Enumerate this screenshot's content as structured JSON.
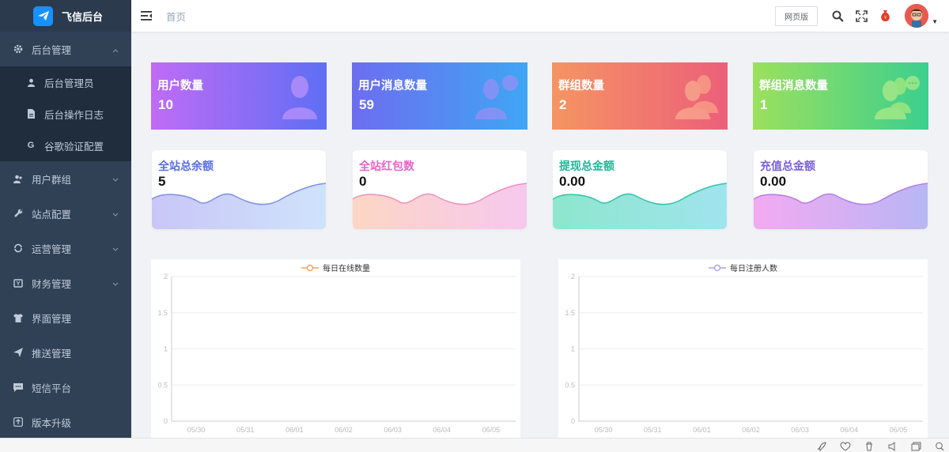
{
  "app": {
    "title": "飞信后台"
  },
  "sidebar": {
    "items": [
      {
        "label": "后台管理",
        "icon": "gear-icon",
        "expanded": true,
        "children": [
          {
            "label": "后台管理员",
            "icon": "user-icon"
          },
          {
            "label": "后台操作日志",
            "icon": "document-icon"
          },
          {
            "label": "谷歌验证配置",
            "icon": "google-icon"
          }
        ]
      },
      {
        "label": "用户群组",
        "icon": "user-group-icon"
      },
      {
        "label": "站点配置",
        "icon": "wrench-icon"
      },
      {
        "label": "运营管理",
        "icon": "sync-icon"
      },
      {
        "label": "财务管理",
        "icon": "wallet-icon"
      },
      {
        "label": "界面管理",
        "icon": "shirt-icon"
      },
      {
        "label": "推送管理",
        "icon": "send-icon"
      },
      {
        "label": "短信平台",
        "icon": "message-icon"
      },
      {
        "label": "版本升级",
        "icon": "upgrade-icon"
      }
    ]
  },
  "header": {
    "breadcrumb": "首页",
    "web_version": "网页版"
  },
  "stats": [
    {
      "label": "用户数量",
      "value": "10"
    },
    {
      "label": "用户消息数量",
      "value": "59"
    },
    {
      "label": "群组数量",
      "value": "2"
    },
    {
      "label": "群组消息数量",
      "value": "1"
    }
  ],
  "waves": [
    {
      "label": "全站总余额",
      "value": "5",
      "color": "#5b6ee1"
    },
    {
      "label": "全站红包数",
      "value": "0",
      "color": "#e963c8"
    },
    {
      "label": "提现总金额",
      "value": "0.00",
      "color": "#23b59b"
    },
    {
      "label": "充值总金额",
      "value": "0.00",
      "color": "#7b61d8"
    }
  ],
  "chart_data": [
    {
      "type": "line",
      "title": "",
      "x": [
        "05/30",
        "05/31",
        "06/01",
        "06/02",
        "06/03",
        "06/04",
        "06/05"
      ],
      "series": [
        {
          "name": "每日在线数量",
          "values": [],
          "color": "#f4a261"
        }
      ],
      "yticks": [
        "0",
        "0.5",
        "1",
        "1.5",
        "2"
      ],
      "ylim": [
        0,
        2
      ],
      "grid": true,
      "legend": "top-center"
    },
    {
      "type": "line",
      "title": "",
      "x": [
        "05/30",
        "05/31",
        "06/01",
        "06/02",
        "06/03",
        "06/04",
        "06/05"
      ],
      "series": [
        {
          "name": "每日注册人数",
          "values": [],
          "color": "#a7a4e8"
        }
      ],
      "yticks": [
        "0",
        "0.5",
        "1",
        "1.5",
        "2"
      ],
      "ylim": [
        0,
        2
      ],
      "grid": true,
      "legend": "top-center"
    }
  ]
}
